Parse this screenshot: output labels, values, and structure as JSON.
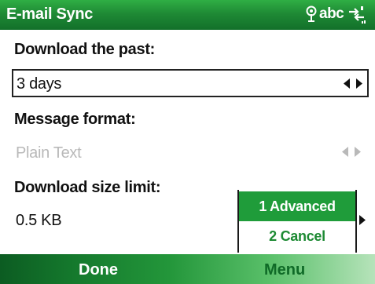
{
  "titlebar": {
    "title": "E-mail Sync",
    "input_mode": "abc",
    "icons": [
      "antenna-signal-icon",
      "sync-arrows-icon"
    ]
  },
  "fields": {
    "download_past": {
      "label": "Download the past:",
      "value": "3 days",
      "enabled": true
    },
    "message_format": {
      "label": "Message format:",
      "value": "Plain Text",
      "enabled": false
    },
    "size_limit": {
      "label": "Download size limit:",
      "value": "0.5 KB"
    }
  },
  "menu": {
    "items": [
      "1 Advanced",
      "2 Cancel"
    ],
    "selected_index": 0
  },
  "softkeys": {
    "left": "Done",
    "right": "Menu"
  },
  "colors": {
    "accent": "#1f9c3a",
    "title_bar": "#1f8a35",
    "disabled_text": "#b9b9b9"
  }
}
